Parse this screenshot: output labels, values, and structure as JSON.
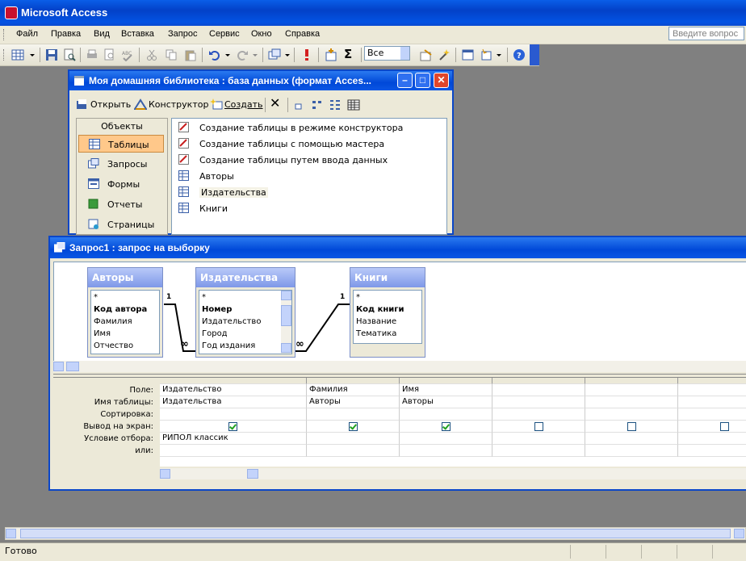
{
  "app": {
    "title": "Microsoft Access"
  },
  "menu": [
    "Файл",
    "Правка",
    "Вид",
    "Вставка",
    "Запрос",
    "Сервис",
    "Окно",
    "Справка"
  ],
  "help": {
    "placeholder": "Введите вопрос"
  },
  "toolbar": {
    "top_values": "Все"
  },
  "db_window": {
    "title": "Моя домашняя библиотека : база данных (формат Acces...",
    "open": "Открыть",
    "designer": "Конструктор",
    "create": "Создать",
    "objects_header": "Объекты",
    "objects": [
      "Таблицы",
      "Запросы",
      "Формы",
      "Отчеты",
      "Страницы"
    ],
    "items": [
      "Создание таблицы в режиме конструктора",
      "Создание таблицы с помощью мастера",
      "Создание таблицы путем ввода данных",
      "Авторы",
      "Издательства",
      "Книги"
    ]
  },
  "query_window": {
    "title": "Запрос1 : запрос на выборку",
    "tables": [
      {
        "name": "Авторы",
        "fields": [
          "*",
          "Код автора",
          "Фамилия",
          "Имя",
          "Отчество"
        ]
      },
      {
        "name": "Издательства",
        "fields": [
          "*",
          "Номер",
          "Издательство",
          "Город",
          "Год издания"
        ]
      },
      {
        "name": "Книги",
        "fields": [
          "*",
          "Код книги",
          "Название",
          "Тематика"
        ]
      }
    ],
    "rel_one": "1",
    "rel_many": "∞",
    "row_labels": [
      "Поле:",
      "Имя таблицы:",
      "Сортировка:",
      "Вывод на экран:",
      "Условие отбора:",
      "или:"
    ],
    "columns": [
      {
        "field": "Издательство",
        "table": "Издательства",
        "show": true,
        "criteria": "РИПОЛ классик"
      },
      {
        "field": "Фамилия",
        "table": "Авторы",
        "show": true,
        "criteria": ""
      },
      {
        "field": "Имя",
        "table": "Авторы",
        "show": true,
        "criteria": ""
      },
      {
        "field": "",
        "table": "",
        "show": false,
        "criteria": ""
      },
      {
        "field": "",
        "table": "",
        "show": false,
        "criteria": ""
      },
      {
        "field": "",
        "table": "",
        "show": false,
        "criteria": ""
      }
    ]
  },
  "status": {
    "text": "Готово"
  },
  "colors": {
    "titlebar": "#0353e3",
    "background": "#808080",
    "selected": "#ffc88a"
  }
}
